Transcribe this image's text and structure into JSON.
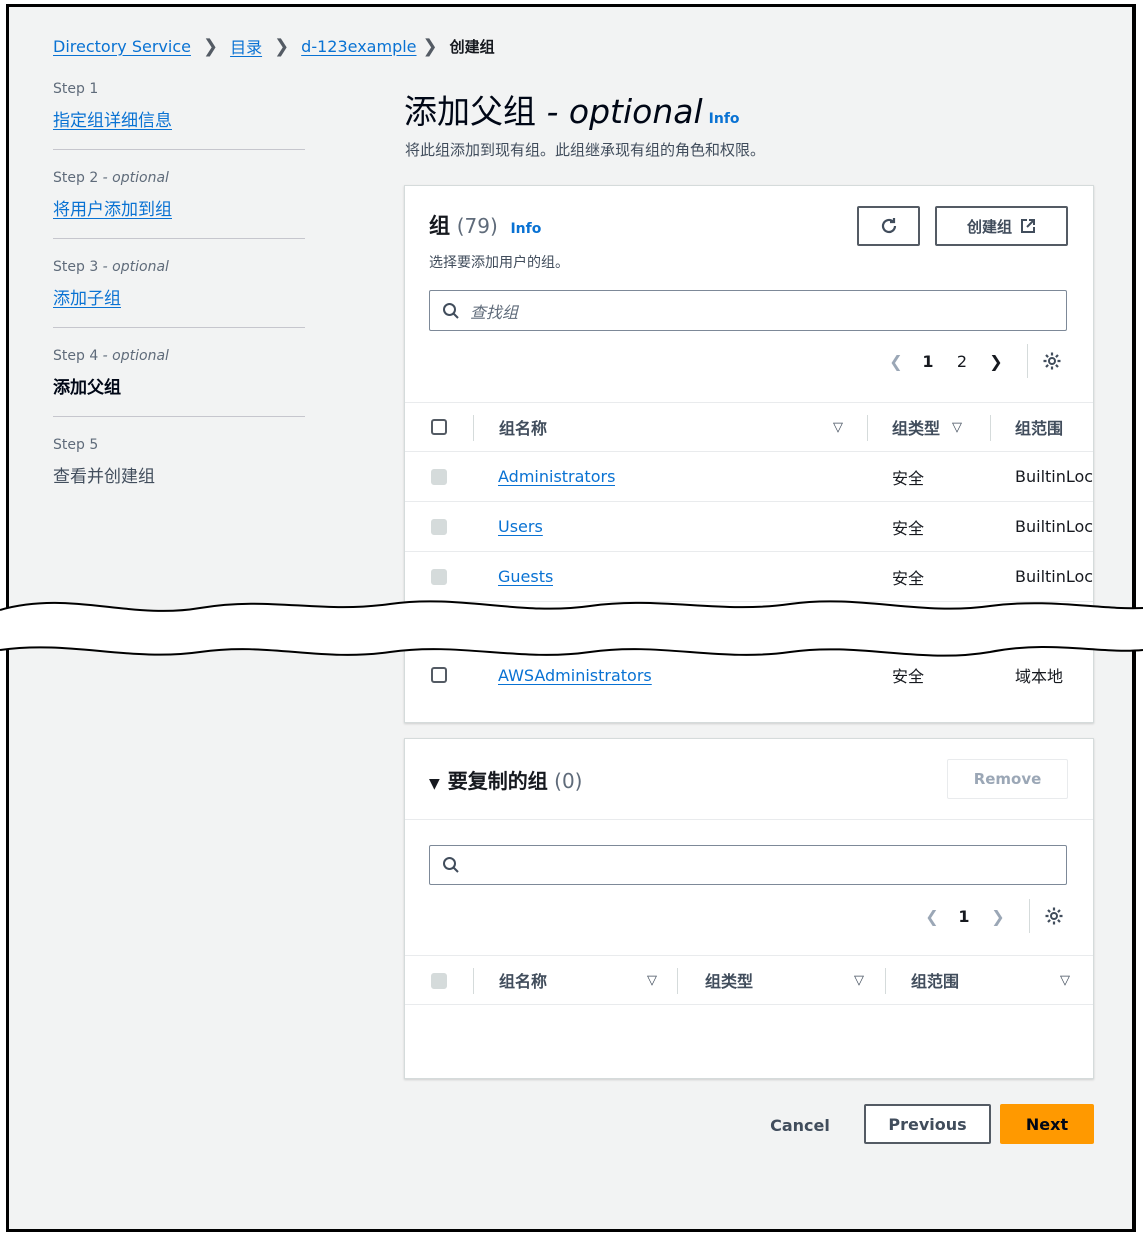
{
  "breadcrumb": {
    "items": [
      "Directory Service",
      "目录",
      "d-123example"
    ],
    "current": "创建组"
  },
  "steps": [
    {
      "label": "Step 1",
      "optional": "",
      "title": "指定组详细信息",
      "state": "link"
    },
    {
      "label": "Step 2",
      "optional": " - optional",
      "title": "将用户添加到组",
      "state": "link"
    },
    {
      "label": "Step 3",
      "optional": " - optional",
      "title": "添加子组",
      "state": "link"
    },
    {
      "label": "Step 4",
      "optional": " - optional",
      "title": "添加父组",
      "state": "active"
    },
    {
      "label": "Step 5",
      "optional": "",
      "title": "查看并创建组",
      "state": "disabled"
    }
  ],
  "page": {
    "title": "添加父组",
    "title_optional": " - optional",
    "info": "Info",
    "description": "将此组添加到现有组。此组继承现有组的角色和权限。"
  },
  "groups_panel": {
    "title": "组",
    "count": "(79)",
    "info": "Info",
    "subtitle": "选择要添加用户的组。",
    "create_label": "创建组",
    "search_placeholder": "查找组",
    "pages": [
      "1",
      "2"
    ],
    "columns": [
      "组名称",
      "组类型",
      "组范围"
    ],
    "rows": [
      {
        "name": "Administrators",
        "type": "安全",
        "scope": "BuiltinLocal"
      },
      {
        "name": "Users",
        "type": "安全",
        "scope": "BuiltinLocal"
      },
      {
        "name": "Guests",
        "type": "安全",
        "scope": "BuiltinLocal"
      },
      {
        "name": "AWSAdministrators",
        "type": "安全",
        "scope": "域本地"
      }
    ]
  },
  "copy_panel": {
    "title": "要复制的组",
    "count": "(0)",
    "remove_label": "Remove",
    "page": "1",
    "columns": [
      "组名称",
      "组类型",
      "组范围"
    ]
  },
  "footer": {
    "cancel": "Cancel",
    "previous": "Previous",
    "next": "Next"
  },
  "colors": {
    "link": "#0972d3",
    "primary": "#ff9900",
    "background": "#f2f3f3"
  }
}
